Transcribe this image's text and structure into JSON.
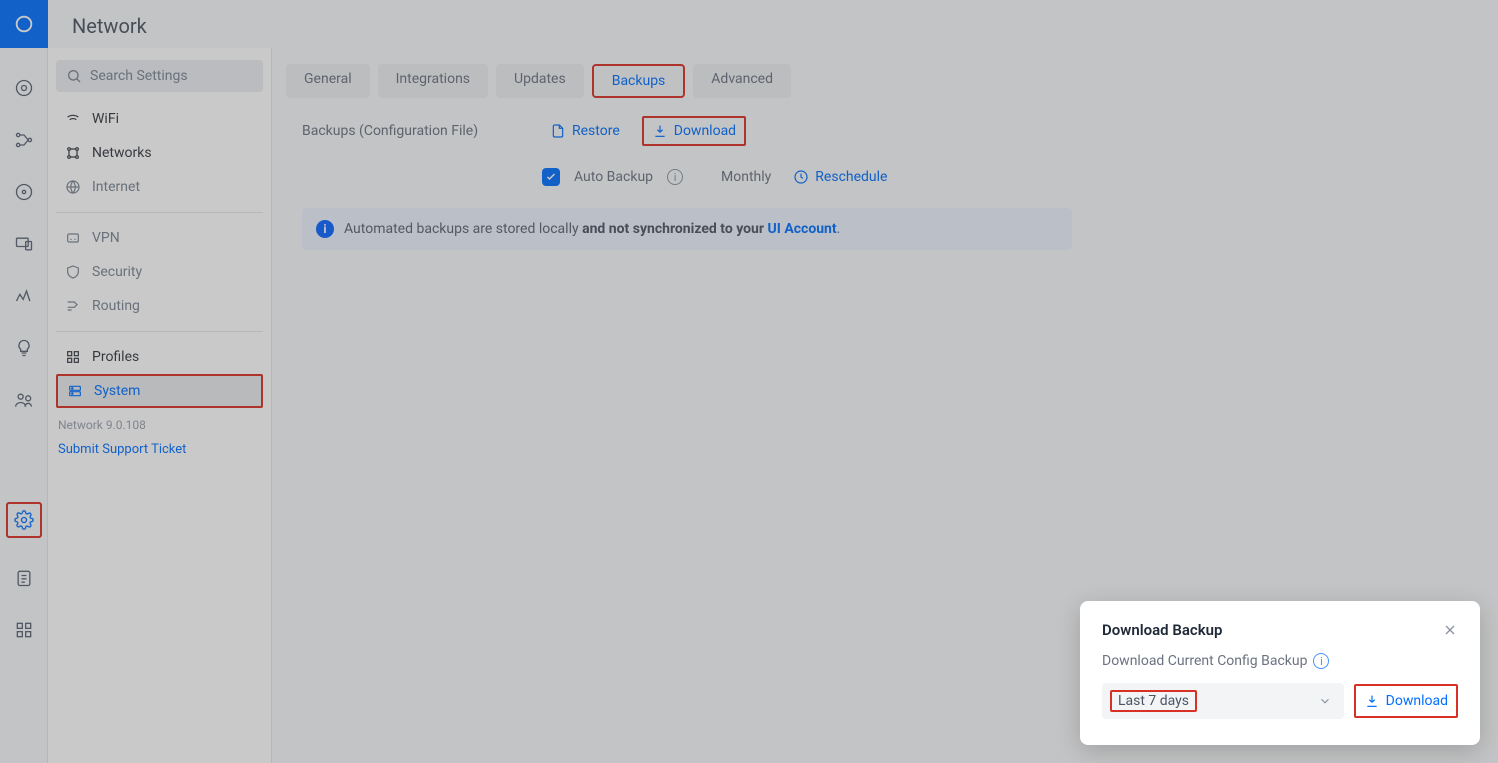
{
  "header": {
    "title": "Network"
  },
  "search": {
    "placeholder": "Search Settings"
  },
  "nav": {
    "wifi": "WiFi",
    "networks": "Networks",
    "internet": "Internet",
    "vpn": "VPN",
    "security": "Security",
    "routing": "Routing",
    "profiles": "Profiles",
    "system": "System",
    "version": "Network 9.0.108",
    "support": "Submit Support Ticket"
  },
  "tabs": {
    "general": "General",
    "integrations": "Integrations",
    "updates": "Updates",
    "backups": "Backups",
    "advanced": "Advanced"
  },
  "backups": {
    "section_label": "Backups (Configuration File)",
    "restore": "Restore",
    "download": "Download",
    "auto_backup": "Auto Backup",
    "frequency": "Monthly",
    "reschedule": "Reschedule",
    "banner_prefix": "Automated backups are stored locally ",
    "banner_bold": "and not synchronized to your ",
    "banner_link": "UI Account"
  },
  "modal": {
    "title": "Download Backup",
    "subtitle": "Download Current Config Backup",
    "select_value": "Last 7 days",
    "download": "Download"
  }
}
